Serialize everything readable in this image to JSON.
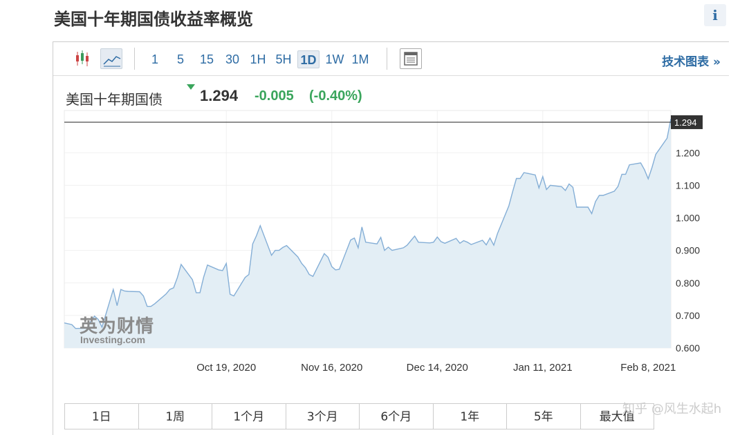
{
  "page": {
    "title": "美国十年期国债收益率概览",
    "info_label": "i"
  },
  "toolbar": {
    "icons": [
      "candlestick-icon",
      "line-chart-icon",
      "table-icon"
    ],
    "ranges": [
      "1",
      "5",
      "15",
      "30",
      "1H",
      "5H",
      "1D",
      "1W",
      "1M"
    ],
    "selected_range": "1D",
    "tech_link": "技术图表 »"
  },
  "quote": {
    "name": "美国十年期国债",
    "price": "1.294",
    "change": "-0.005",
    "change_pct": "(-0.40%)",
    "color_down": "#3aa55c"
  },
  "logo": {
    "cn": "英为财情",
    "en": "Investing.com"
  },
  "periods": [
    "1日",
    "1周",
    "1个月",
    "3个月",
    "6个月",
    "1年",
    "5年",
    "最大值"
  ],
  "watermark": "知乎 @风生水起h",
  "chart_data": {
    "type": "area",
    "title": "",
    "xlabel": "",
    "ylabel": "",
    "ylim": [
      0.6,
      1.33
    ],
    "grid": true,
    "y_ticks": [
      "0.600",
      "0.700",
      "0.800",
      "0.900",
      "1.000",
      "1.100",
      "1.200"
    ],
    "x_ticks": [
      "Oct 19, 2020",
      "Nov 16, 2020",
      "Dec 14, 2020",
      "Jan 11, 2021",
      "Feb 8, 2021"
    ],
    "x_ticks_days": [
      43,
      71,
      99,
      127,
      155
    ],
    "last_value_label": "1.294",
    "last_value": 1.294,
    "colors": {
      "line": "#84aed6",
      "fill": "#e3eef5",
      "last_line": "#222222",
      "label_bg": "#333333"
    },
    "series": [
      {
        "x_days": [
          0,
          2,
          3,
          6,
          7,
          8,
          9,
          10,
          13,
          14,
          15,
          16,
          17,
          20,
          21,
          22,
          23,
          24,
          27,
          28,
          29,
          30,
          31,
          34,
          35,
          36,
          37,
          38,
          41,
          42,
          43,
          44,
          45,
          48,
          49,
          50,
          51,
          52,
          55,
          56,
          57,
          58,
          59,
          62,
          63,
          64,
          65,
          66,
          69,
          70,
          71,
          72,
          73,
          76,
          77,
          78,
          79,
          80,
          83,
          84,
          85,
          86,
          87,
          90,
          91,
          92,
          93,
          94,
          97,
          98,
          99,
          100,
          101,
          104,
          105,
          106,
          107,
          108,
          111,
          112,
          113,
          114,
          115,
          118,
          119,
          120,
          121,
          122,
          125,
          126,
          127,
          128,
          129,
          132,
          133,
          134,
          135,
          136,
          139,
          140,
          141,
          142,
          143,
          146,
          147,
          148,
          149,
          150,
          153,
          154,
          155,
          156,
          157,
          160,
          161
        ],
        "values": [
          0.677,
          0.672,
          0.66,
          0.661,
          0.681,
          0.698,
          0.688,
          0.664,
          0.78,
          0.73,
          0.78,
          0.775,
          0.774,
          0.773,
          0.76,
          0.728,
          0.728,
          0.736,
          0.766,
          0.78,
          0.785,
          0.816,
          0.857,
          0.81,
          0.77,
          0.77,
          0.818,
          0.855,
          0.84,
          0.838,
          0.86,
          0.765,
          0.76,
          0.817,
          0.826,
          0.92,
          0.945,
          0.976,
          0.885,
          0.9,
          0.9,
          0.909,
          0.915,
          0.88,
          0.86,
          0.847,
          0.826,
          0.82,
          0.89,
          0.879,
          0.85,
          0.84,
          0.842,
          0.932,
          0.938,
          0.908,
          0.972,
          0.925,
          0.92,
          0.94,
          0.9,
          0.91,
          0.9,
          0.908,
          0.916,
          0.93,
          0.944,
          0.925,
          0.923,
          0.925,
          0.941,
          0.927,
          0.922,
          0.937,
          0.922,
          0.93,
          0.925,
          0.918,
          0.931,
          0.917,
          0.938,
          0.916,
          0.952,
          1.037,
          1.08,
          1.121,
          1.121,
          1.139,
          1.132,
          1.092,
          1.127,
          1.087,
          1.1,
          1.096,
          1.084,
          1.104,
          1.094,
          1.033,
          1.033,
          1.013,
          1.05,
          1.069,
          1.069,
          1.082,
          1.097,
          1.134,
          1.134,
          1.163,
          1.169,
          1.148,
          1.12,
          1.155,
          1.195,
          1.245,
          1.304
        ]
      }
    ]
  }
}
